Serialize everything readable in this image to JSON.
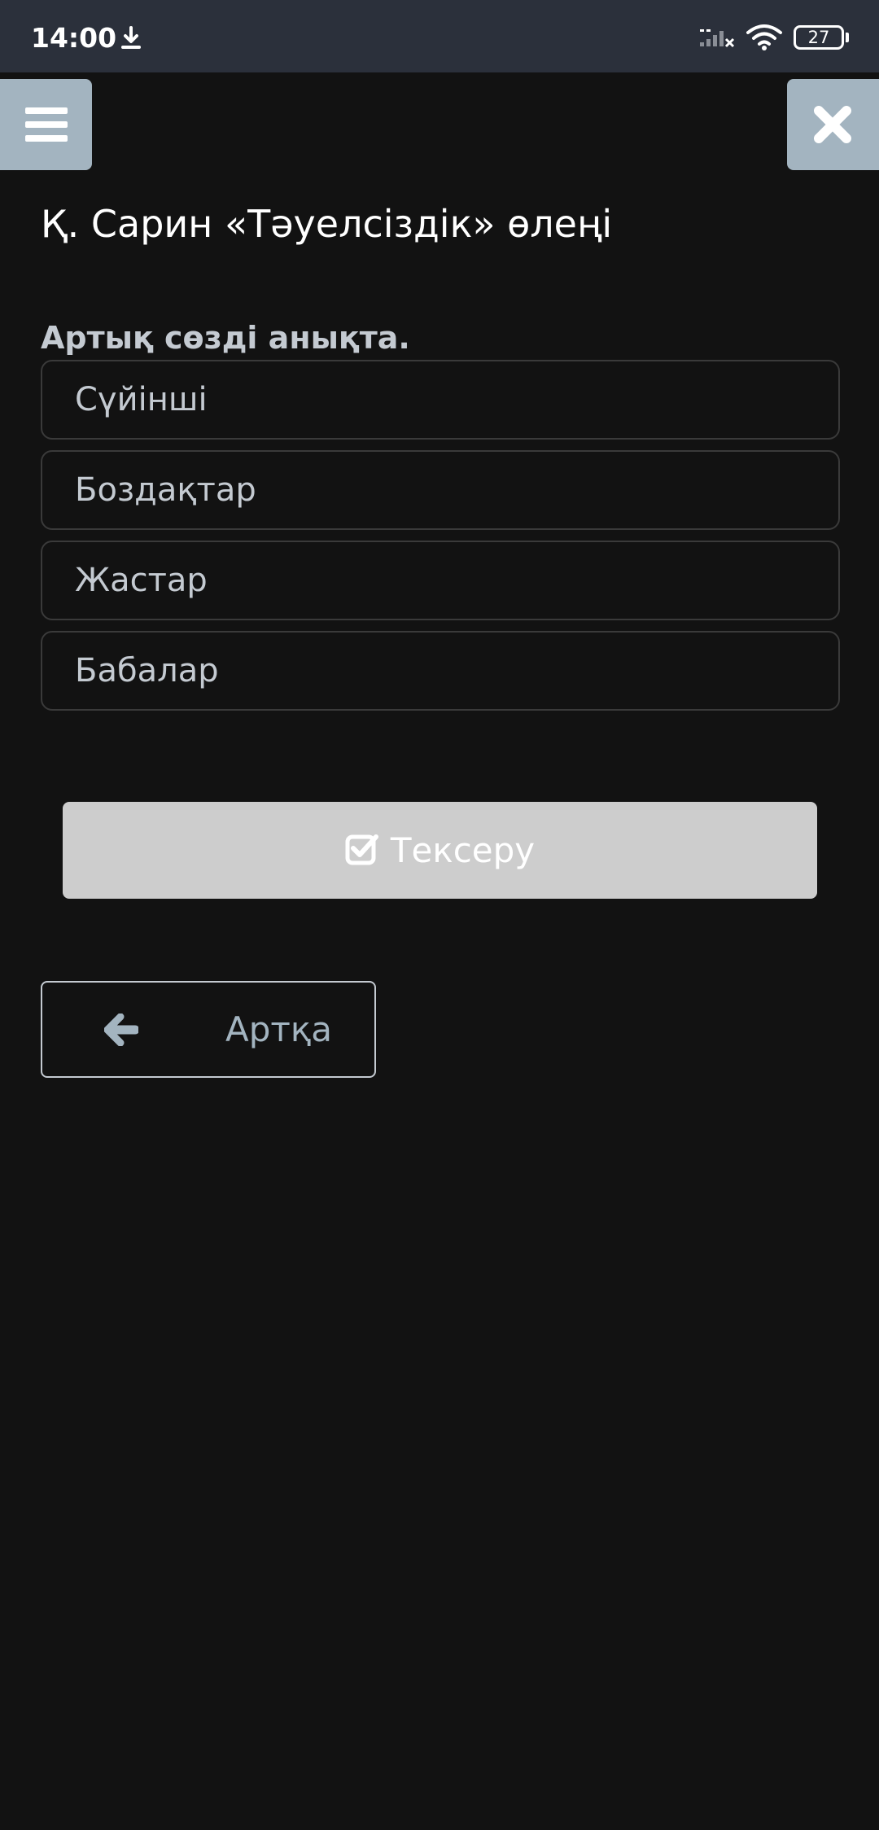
{
  "status_bar": {
    "time": "14:00",
    "battery": "27",
    "icons": [
      "download-icon",
      "signal-icon",
      "wifi-icon",
      "battery-icon"
    ]
  },
  "header": {
    "menu_icon": "menu-icon",
    "close_icon": "close-icon",
    "button_color": "#a3b4c0"
  },
  "main": {
    "title": "Қ. Сарин «Тәуелсіздік» өлеңі",
    "question": "Артық сөзді анықта.",
    "options": [
      {
        "label": "Сүйінші"
      },
      {
        "label": "Боздақтар"
      },
      {
        "label": "Жастар"
      },
      {
        "label": "Бабалар"
      }
    ],
    "check_button": {
      "label": "Тексеру",
      "icon": "check-square-icon"
    },
    "back_button": {
      "label": "Артқа",
      "icon": "arrow-left-icon"
    }
  },
  "colors": {
    "background": "#121212",
    "status_bar": "#2b303b",
    "accent": "#a3b4c0",
    "check_button": "#cdcdcd"
  }
}
